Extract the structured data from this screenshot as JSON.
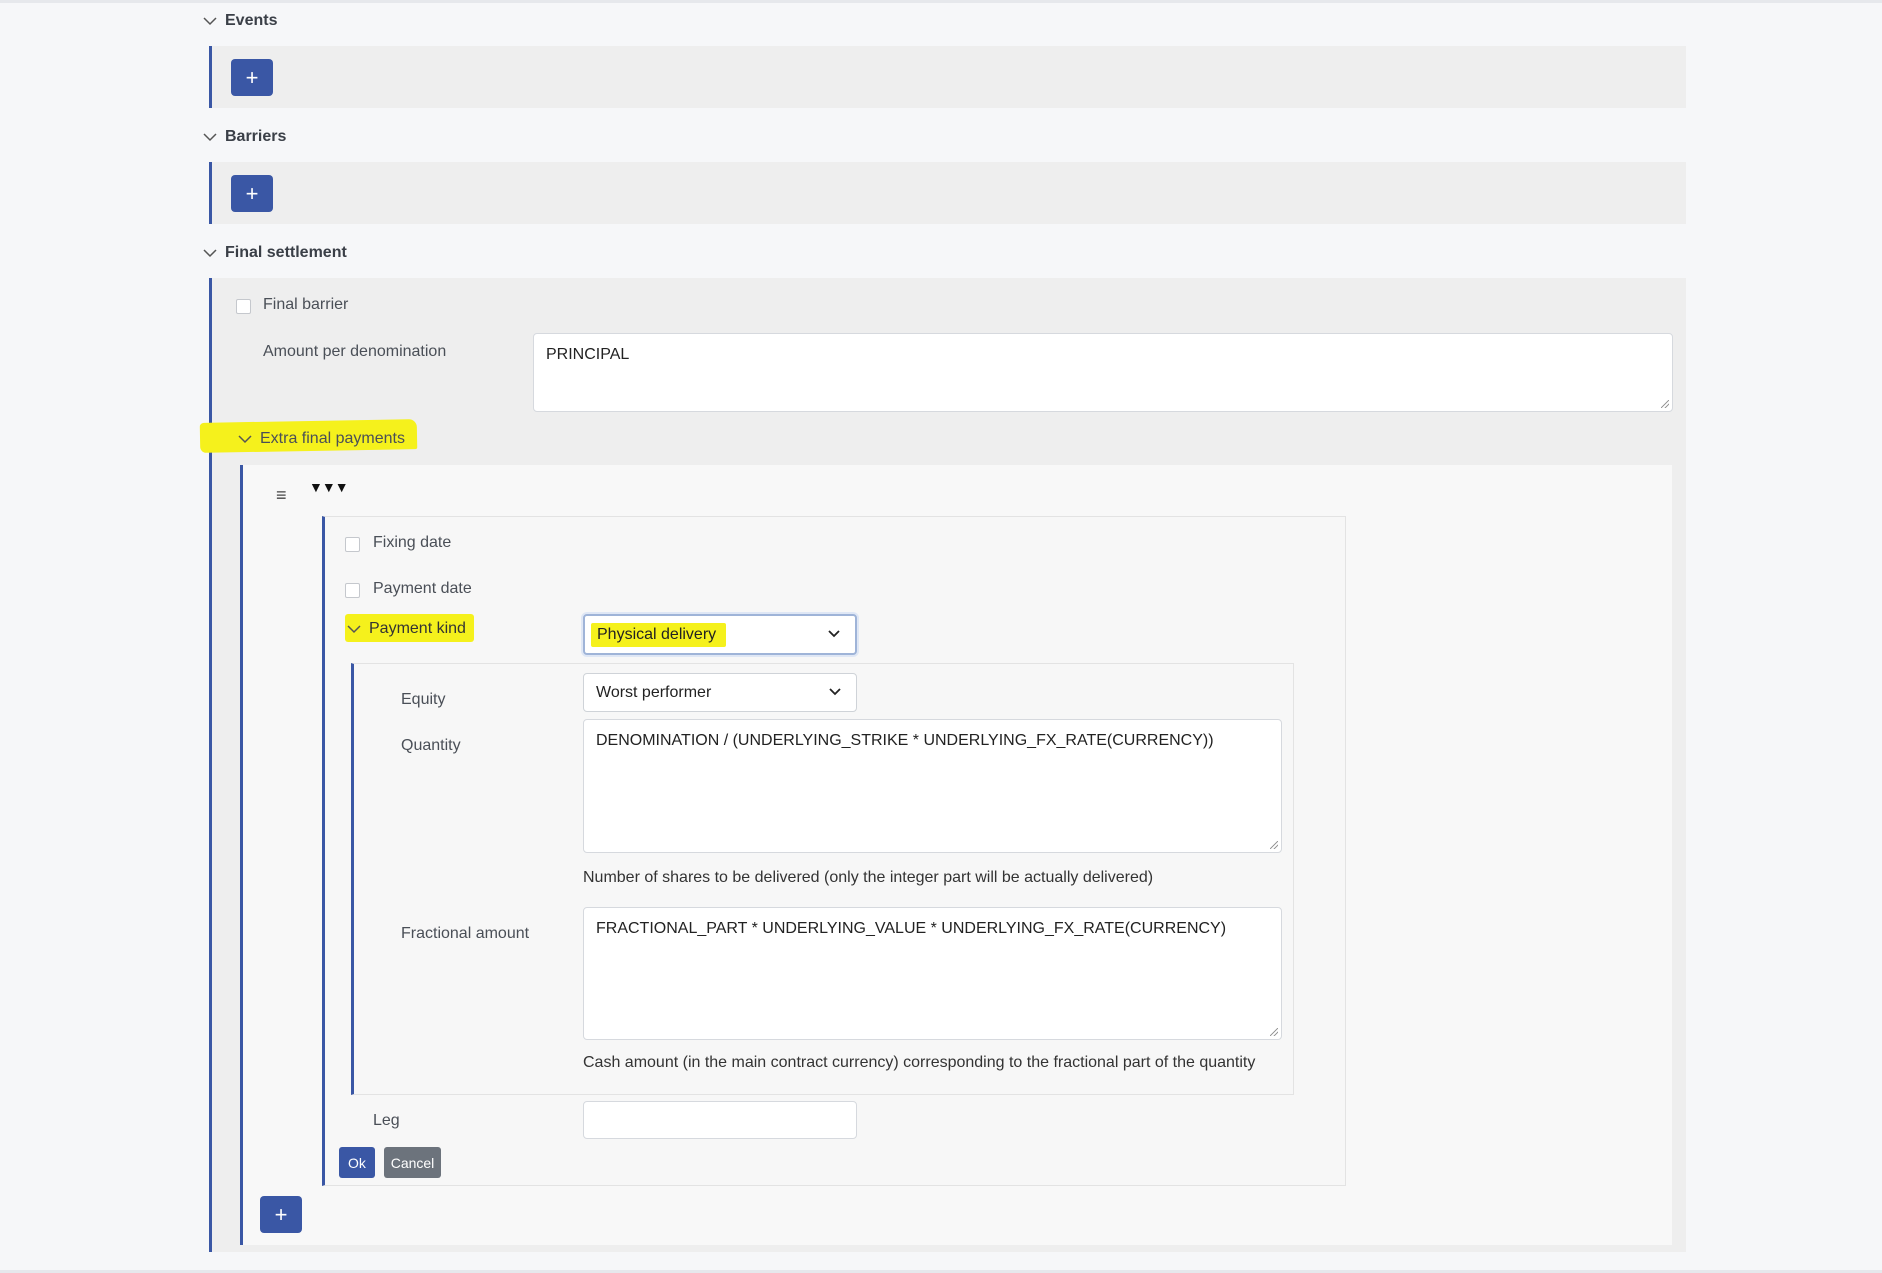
{
  "sections": {
    "events": {
      "title": "Events",
      "add_label": "+"
    },
    "barriers": {
      "title": "Barriers",
      "add_label": "+"
    },
    "final_settlement": {
      "title": "Final settlement",
      "final_barrier_label": "Final barrier",
      "amount_label": "Amount per denomination",
      "amount_value": "PRINCIPAL",
      "extra_final_payments": {
        "title": "Extra final payments",
        "menu_icon": "≡",
        "collapse_arrows": "▼▼▼",
        "fixing_date_label": "Fixing date",
        "payment_date_label": "Payment date",
        "payment_kind_label": "Payment kind",
        "payment_kind_value": "Physical delivery",
        "equity_label": "Equity",
        "equity_value": "Worst performer",
        "quantity_label": "Quantity",
        "quantity_value": "DENOMINATION / (UNDERLYING_STRIKE * UNDERLYING_FX_RATE(CURRENCY))",
        "quantity_help": "Number of shares to be delivered (only the integer part will be actually delivered)",
        "fractional_label": "Fractional amount",
        "fractional_value": "FRACTIONAL_PART * UNDERLYING_VALUE * UNDERLYING_FX_RATE(CURRENCY)",
        "fractional_help": "Cash amount (in the main contract currency) corresponding to the fractional part of the quantity",
        "leg_label": "Leg",
        "leg_value": "",
        "ok_label": "Ok",
        "cancel_label": "Cancel",
        "add_label": "+"
      }
    }
  },
  "colors": {
    "accent": "#3a57a5",
    "highlight": "#f5f11c",
    "secondary": "#6c737c"
  }
}
